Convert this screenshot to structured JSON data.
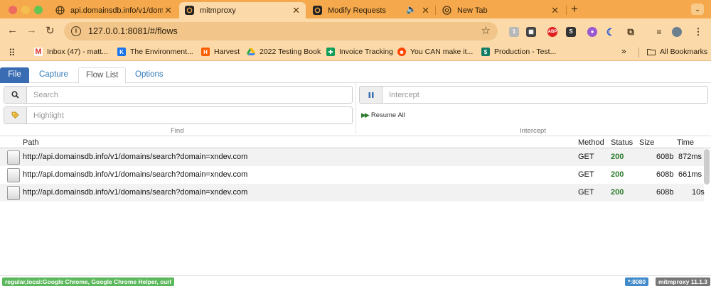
{
  "browser": {
    "tabs": [
      {
        "title": "api.domainsdb.info/v1/domain",
        "active": false
      },
      {
        "title": "mitmproxy",
        "active": true
      },
      {
        "title": "Modify Requests",
        "active": false
      },
      {
        "title": "New Tab",
        "active": false
      }
    ],
    "new_tab": "+",
    "url": "127.0.0.1:8081/#/flows",
    "bookmarks": [
      {
        "label": "Inbox (47) - matt...",
        "icon": "gmail-icon",
        "color": "#d93025"
      },
      {
        "label": "The Environment...",
        "icon": "k-icon",
        "color": "#1a73e8"
      },
      {
        "label": "Harvest",
        "icon": "harvest-icon",
        "color": "#fa5d00"
      },
      {
        "label": "2022 Testing Book",
        "icon": "drive-icon",
        "color": "#34a853"
      },
      {
        "label": "Invoice Tracking",
        "icon": "sheets-icon",
        "color": "#0f9d58"
      },
      {
        "label": "You CAN make it...",
        "icon": "reddit-icon",
        "color": "#ff4500"
      },
      {
        "label": "Production - Test...",
        "icon": "s-icon",
        "color": "#107c64"
      }
    ],
    "more_bookmarks": "»",
    "all_bookmarks": "All Bookmarks"
  },
  "mitm": {
    "menu": {
      "file": "File",
      "capture": "Capture",
      "flow_list": "Flow List",
      "options": "Options"
    },
    "search_placeholder": "Search",
    "highlight_placeholder": "Highlight",
    "intercept_placeholder": "Intercept",
    "find_label": "Find",
    "intercept_label": "Intercept",
    "resume_all": "Resume All",
    "columns": {
      "path": "Path",
      "method": "Method",
      "status": "Status",
      "size": "Size",
      "time": "Time"
    },
    "flows": [
      {
        "path": "http://api.domainsdb.info/v1/domains/search?domain=xndev.com",
        "method": "GET",
        "status": "200",
        "size": "608b",
        "time": "872ms"
      },
      {
        "path": "http://api.domainsdb.info/v1/domains/search?domain=xndev.com",
        "method": "GET",
        "status": "200",
        "size": "608b",
        "time": "661ms"
      },
      {
        "path": "http://api.domainsdb.info/v1/domains/search?domain=xndev.com",
        "method": "GET",
        "status": "200",
        "size": "608b",
        "time": "10s"
      }
    ],
    "footer": {
      "mode": "regular,local:Google Chrome, Google Chrome Helper, curl",
      "port": "*:8080",
      "version": "mitmproxy 11.1.3"
    }
  }
}
